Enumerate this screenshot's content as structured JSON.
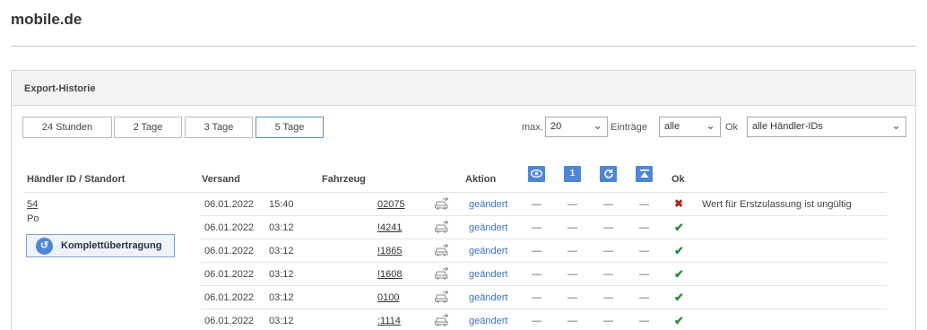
{
  "brand": "mobile.de",
  "panel_title": "Export-Historie",
  "range_buttons": [
    "24 Stunden",
    "2 Tage",
    "3 Tage",
    "5 Tage"
  ],
  "active_range": "5 Tage",
  "filters": {
    "max_label": "max.",
    "max_value": "20",
    "entries_label": "Einträge",
    "status_value": "alle",
    "ok_label": "Ok",
    "dealer_value": "alle Händler-IDs"
  },
  "columns": {
    "dealer": "Händler ID / Standort",
    "sent": "Versand",
    "vehicle": "Fahrzeug",
    "action": "Aktion",
    "ok": "Ok"
  },
  "header_icons": [
    "eye-icon",
    "number-one-icon",
    "refresh-icon",
    "upload-icon"
  ],
  "dealer": {
    "id": "54",
    "location": "Po",
    "full_transfer_label": "Komplettübertragung"
  },
  "rows": [
    {
      "date": "06.01.2022",
      "time": "15:40",
      "vehicle": "02075",
      "action": "geändert",
      "c1": "—",
      "c2": "—",
      "c3": "—",
      "c4": "—",
      "ok": "error",
      "message": "Wert für Erstzulassung ist ungültig"
    },
    {
      "date": "06.01.2022",
      "time": "03:12",
      "vehicle": "!4241",
      "action": "geändert",
      "c1": "—",
      "c2": "—",
      "c3": "—",
      "c4": "—",
      "ok": "success",
      "message": ""
    },
    {
      "date": "06.01.2022",
      "time": "03:12",
      "vehicle": "!1865",
      "action": "geändert",
      "c1": "—",
      "c2": "—",
      "c3": "—",
      "c4": "—",
      "ok": "success",
      "message": ""
    },
    {
      "date": "06.01.2022",
      "time": "03:12",
      "vehicle": "!1608",
      "action": "geändert",
      "c1": "—",
      "c2": "—",
      "c3": "—",
      "c4": "—",
      "ok": "success",
      "message": ""
    },
    {
      "date": "06.01.2022",
      "time": "03:12",
      "vehicle": "0100",
      "action": "geändert",
      "c1": "—",
      "c2": "—",
      "c3": "—",
      "c4": "—",
      "ok": "success",
      "message": ""
    },
    {
      "date": "06.01.2022",
      "time": "03:12",
      "vehicle": ":1114",
      "action": "geändert",
      "c1": "—",
      "c2": "—",
      "c3": "—",
      "c4": "—",
      "ok": "success",
      "message": ""
    }
  ],
  "colors": {
    "accent": "#4f86d4",
    "link": "#3b73b8",
    "success": "#2c8a3f",
    "error": "#b02323"
  }
}
